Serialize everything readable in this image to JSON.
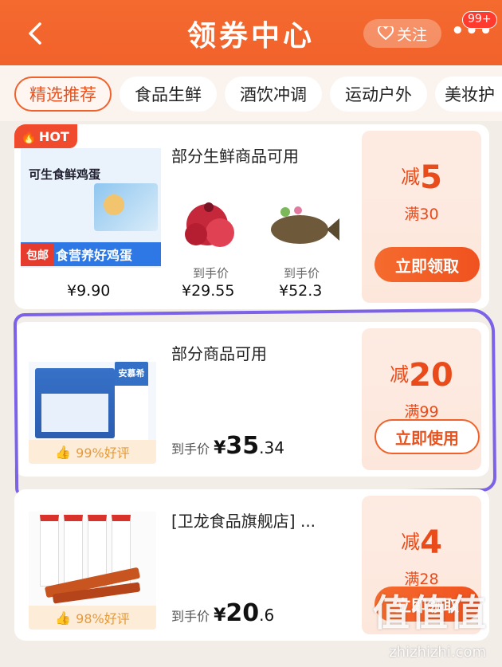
{
  "header": {
    "title": "领券中心",
    "follow_label": "关注",
    "more_glyph": "•••",
    "badge": "99+"
  },
  "tabs": [
    "精选推荐",
    "食品生鲜",
    "酒饮冲调",
    "运动户外",
    "美妆护"
  ],
  "coupons": [
    {
      "hot": "HOT",
      "scope": "部分生鲜商品可用",
      "reduce_prefix": "减",
      "reduce": "5",
      "threshold": "满30",
      "button": "立即领取",
      "products": [
        {
          "label": "",
          "price": "¥9.90",
          "img_text": [
            "可生食鲜鸡蛋",
            "食营养好鸡蛋",
            "包邮"
          ]
        },
        {
          "label": "到手价",
          "price": "¥29.55"
        },
        {
          "label": "到手价",
          "price": "¥52.3"
        }
      ]
    },
    {
      "scope": "部分商品可用",
      "reduce_prefix": "减",
      "reduce": "20",
      "threshold": "满99",
      "button": "立即使用",
      "rating": "99%好评",
      "price_label": "到手价",
      "price_yen": "¥",
      "price_int": "35",
      "price_dec": ".34",
      "img_text": "安慕希"
    },
    {
      "scope": "[卫龙食品旗舰店] ...",
      "reduce_prefix": "减",
      "reduce": "4",
      "threshold": "满28",
      "button": "立即领取",
      "rating": "98%好评",
      "price_label": "到手价",
      "price_yen": "¥",
      "price_int": "20",
      "price_dec": ".6"
    }
  ],
  "watermark": {
    "main": "值值值",
    "sub": "zhizhizhi.com"
  },
  "colors": {
    "brand": "#f1622b",
    "accent": "#ea4b1a",
    "annotation": "#7b62e8"
  }
}
